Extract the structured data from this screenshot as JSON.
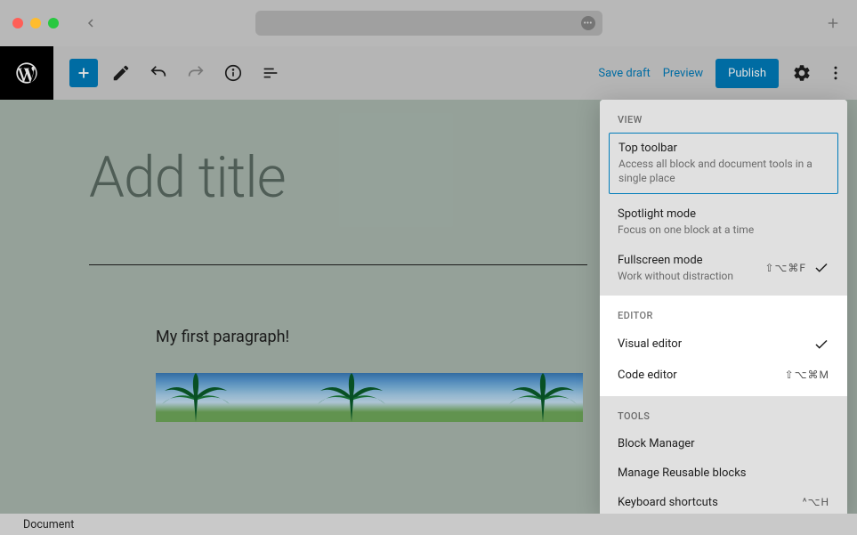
{
  "toolbar": {
    "save_draft": "Save draft",
    "preview": "Preview",
    "publish": "Publish"
  },
  "editor": {
    "title_placeholder": "Add title",
    "paragraph": "My first paragraph!"
  },
  "menu": {
    "view_header": "VIEW",
    "editor_header": "EDITOR",
    "tools_header": "TOOLS",
    "top_toolbar": {
      "label": "Top toolbar",
      "desc": "Access all block and document tools in a single place"
    },
    "spotlight": {
      "label": "Spotlight mode",
      "desc": "Focus on one block at a time"
    },
    "fullscreen": {
      "label": "Fullscreen mode",
      "desc": "Work without distraction",
      "shortcut": "⇧⌥⌘F"
    },
    "visual_editor": {
      "label": "Visual editor"
    },
    "code_editor": {
      "label": "Code editor",
      "shortcut": "⇧⌥⌘M"
    },
    "block_manager": {
      "label": "Block Manager"
    },
    "reusable": {
      "label": "Manage Reusable blocks"
    },
    "keyboard": {
      "label": "Keyboard shortcuts",
      "shortcut": "^⌥H"
    }
  },
  "footer": {
    "breadcrumb": "Document"
  }
}
